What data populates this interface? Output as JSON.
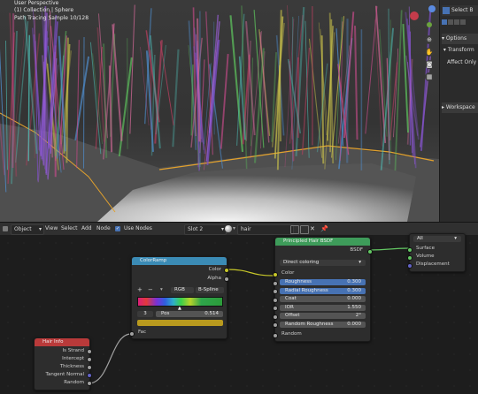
{
  "viewport": {
    "overlay_lines": [
      "User Perspective",
      "(1) Collection | Sphere",
      "Path Tracing Sample 10/128"
    ]
  },
  "right_panel": {
    "select_label": "Select B",
    "options_label": "Options",
    "transform_label": "Transform",
    "affect_only_label": "Affect Only",
    "workspace_label": "Workspace"
  },
  "node_header": {
    "object_label": "Object",
    "menus": [
      "View",
      "Select",
      "Add",
      "Node"
    ],
    "use_nodes_label": "Use Nodes",
    "use_nodes_checked": true,
    "slot_label": "Slot 2",
    "material_name": "hair"
  },
  "nodes": {
    "hair_info": {
      "title": "Hair Info",
      "outputs": [
        "Is Strand",
        "Intercept",
        "Thickness",
        "Tangent Normal",
        "Random"
      ]
    },
    "colorramp": {
      "title": "ColorRamp",
      "outputs": [
        "Color",
        "Alpha"
      ],
      "plus": "+",
      "minus": "−",
      "color_mode": "RGB",
      "interpolation": "B-Spline",
      "stop_index": "3",
      "pos_label": "Pos",
      "pos_value": "0.514",
      "stop_color": "#b99a1e",
      "input_label": "Fac"
    },
    "hair_bsdf": {
      "title": "Principled Hair BSDF",
      "output": "BSDF",
      "parametrization": "Direct coloring",
      "color_label": "Color",
      "fields": [
        {
          "label": "Roughness",
          "value": "0.300",
          "highlight": true
        },
        {
          "label": "Radial Roughness",
          "value": "0.300",
          "highlight": true
        },
        {
          "label": "Coat",
          "value": "0.000",
          "highlight": false
        },
        {
          "label": "IOR",
          "value": "1.550",
          "highlight": false
        },
        {
          "label": "Offset",
          "value": "2°",
          "highlight": false
        },
        {
          "label": "Random Roughness",
          "value": "0.000",
          "highlight": false
        }
      ],
      "random_label": "Random"
    },
    "material_output": {
      "target": "All",
      "inputs": [
        "Surface",
        "Volume",
        "Displacement"
      ]
    }
  },
  "colors": {
    "accent": "#e2732d",
    "hair_info_header": "#b93a3a",
    "colorramp_header": "#3b8bb5",
    "bsdf_header": "#3e9c5a",
    "socket_float": "#a1a1a1",
    "socket_color": "#c7c729",
    "socket_shader": "#63c763",
    "highlight_field": "#4772b3"
  }
}
